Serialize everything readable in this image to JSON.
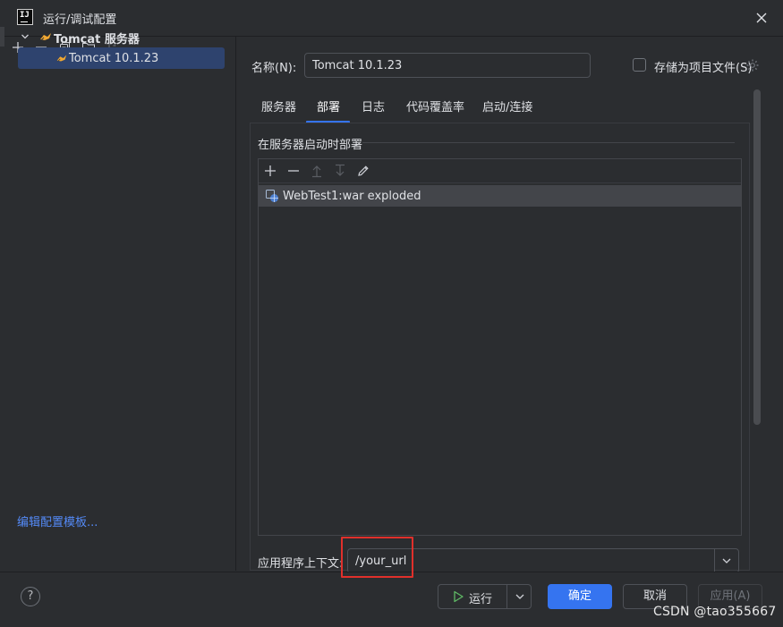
{
  "window": {
    "title": "运行/调试配置",
    "app_icon_text": "IJ"
  },
  "left_panel": {
    "toolbar_icons": [
      "add-icon",
      "remove-icon",
      "copy-icon",
      "new-folder-icon",
      "sort-icon"
    ],
    "tree": {
      "group_label": "Tomcat 服务器",
      "child_label": "Tomcat 10.1.23"
    },
    "edit_templates_link": "编辑配置模板..."
  },
  "config": {
    "name_label": "名称(N):",
    "name_value": "Tomcat 10.1.23",
    "store_as_project_label": "存储为项目文件(S)",
    "store_as_project_checked": false
  },
  "tabs": [
    "服务器",
    "部署",
    "日志",
    "代码覆盖率",
    "启动/连接"
  ],
  "active_tab": "部署",
  "deployment": {
    "section_title": "在服务器启动时部署",
    "artifacts": [
      {
        "label": "WebTest1:war exploded"
      }
    ],
    "context_label": "应用程序上下文:",
    "context_value": "/your_url"
  },
  "buttons": {
    "help": "?",
    "run": "运行",
    "ok": "确定",
    "cancel": "取消",
    "apply": "应用(A)"
  },
  "colors": {
    "accent": "#3574f0",
    "selection": "#2e436e",
    "highlight_box": "#e0302b",
    "link": "#548af7",
    "background": "#2b2d30",
    "run_green": "#5fb865",
    "tomcat_orange": "#f0a732"
  },
  "watermark": "CSDN @tao355667"
}
